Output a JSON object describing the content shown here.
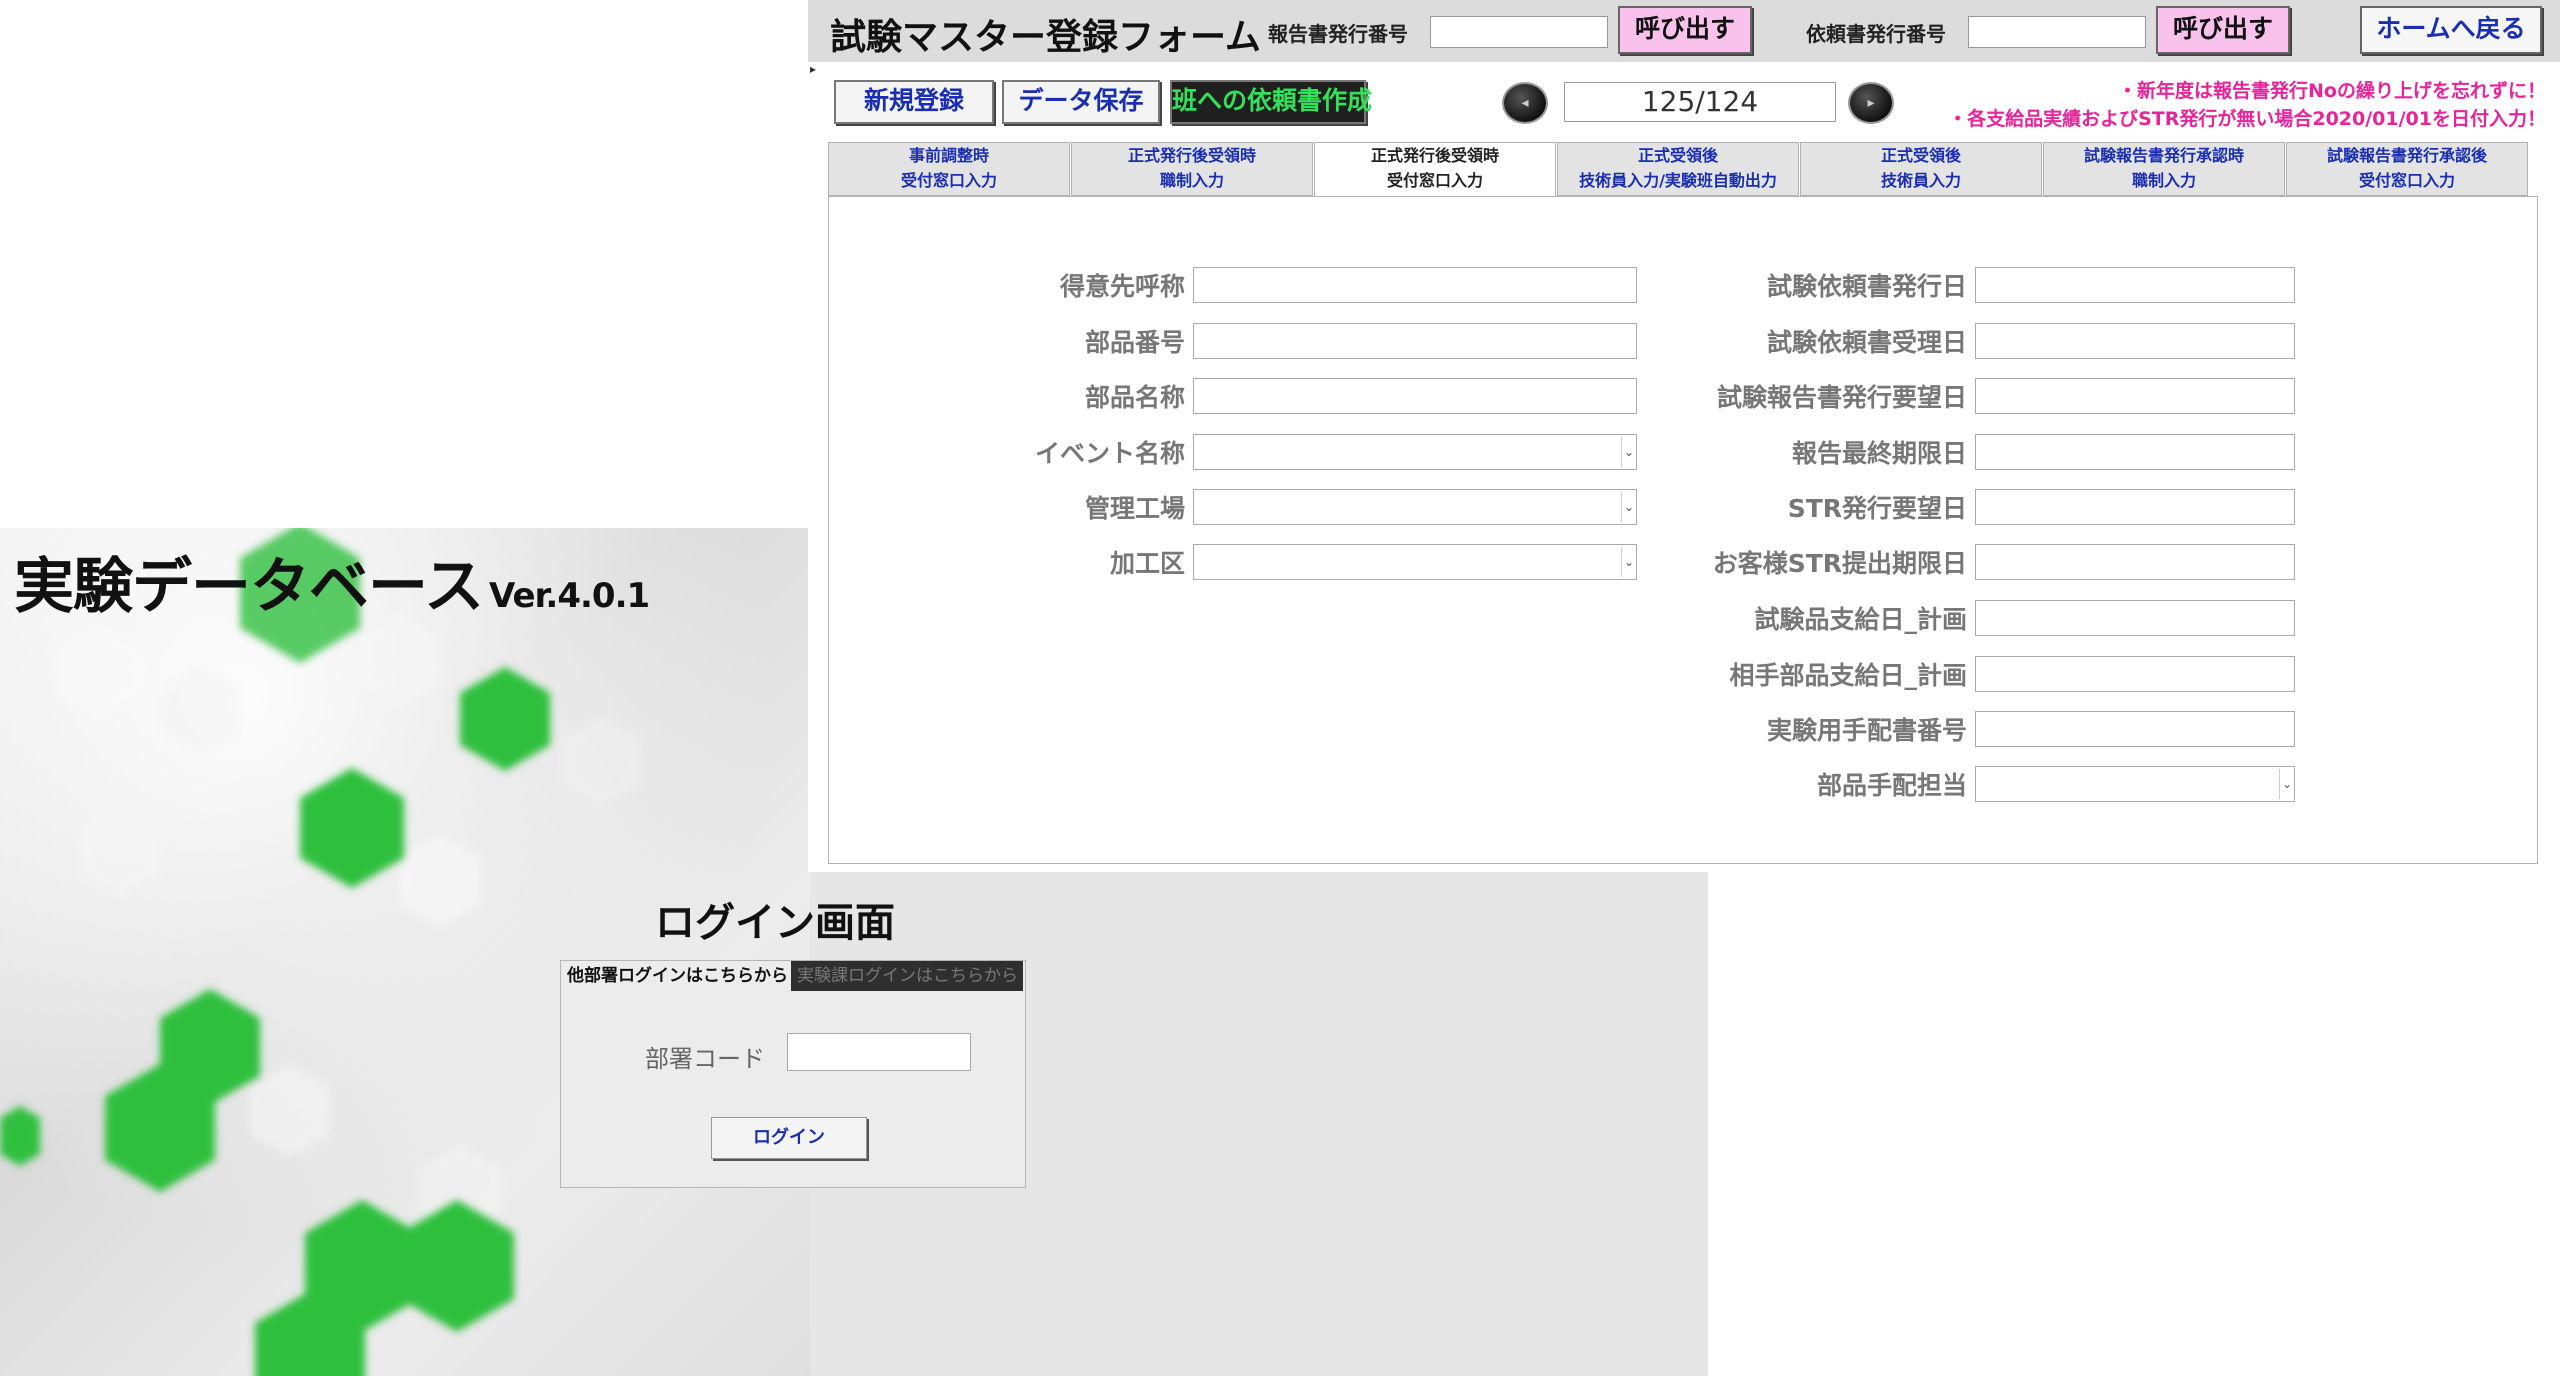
{
  "login_screen": {
    "app_title": "実験データベース",
    "version": "Ver.4.0.1",
    "login_title": "ログイン画面",
    "tabs": [
      {
        "label": "他部署ログインはこちらから"
      },
      {
        "label": "実験課ログインはこちらから"
      }
    ],
    "dept_code_label": "部署コード",
    "dept_code_value": "",
    "login_button": "ログイン"
  },
  "main_form": {
    "title": "試験マスター登録フォーム",
    "report_no_label": "報告書発行番号",
    "report_no_value": "",
    "call_button_1": "呼び出す",
    "request_no_label": "依頼書発行番号",
    "request_no_value": "",
    "call_button_2": "呼び出す",
    "home_button": "ホームへ戻る",
    "toolbar": {
      "new_label": "新規登録",
      "save_label": "データ保存",
      "request_label": "班への依頼書作成"
    },
    "record_counter": "125/124",
    "notices": [
      "・新年度は報告書発行Noの繰り上げを忘れずに！",
      "・各支給品実績およびSTR発行が無い場合2020/01/01を日付入力！"
    ],
    "tabs": [
      {
        "line1": "事前調整時",
        "line2": "受付窓口入力"
      },
      {
        "line1": "正式発行後受領時",
        "line2": "職制入力"
      },
      {
        "line1": "正式発行後受領時",
        "line2": "受付窓口入力"
      },
      {
        "line1": "正式受領後",
        "line2": "技術員入力/実験班自動出力"
      },
      {
        "line1": "正式受領後",
        "line2": "技術員入力"
      },
      {
        "line1": "試験報告書発行承認時",
        "line2": "職制入力"
      },
      {
        "line1": "試験報告書発行承認後",
        "line2": "受付窓口入力"
      }
    ],
    "active_tab": 2,
    "left_fields": [
      {
        "label": "得意先呼称",
        "value": ""
      },
      {
        "label": "部品番号",
        "value": ""
      },
      {
        "label": "部品名称",
        "value": ""
      },
      {
        "label": "イベント名称",
        "value": ""
      },
      {
        "label": "管理工場",
        "value": ""
      },
      {
        "label": "加工区",
        "value": ""
      }
    ],
    "right_fields": [
      {
        "label": "試験依頼書発行日",
        "value": ""
      },
      {
        "label": "試験依頼書受理日",
        "value": ""
      },
      {
        "label": "試験報告書発行要望日",
        "value": ""
      },
      {
        "label": "報告最終期限日",
        "value": ""
      },
      {
        "label": "STR発行要望日",
        "value": ""
      },
      {
        "label": "お客様STR提出期限日",
        "value": ""
      },
      {
        "label": "試験品支給日_計画",
        "value": ""
      },
      {
        "label": "相手部品支給日_計画",
        "value": ""
      },
      {
        "label": "実験用手配書番号",
        "value": ""
      },
      {
        "label": "部品手配担当",
        "value": ""
      }
    ]
  },
  "colors": {
    "link_blue": "#1a2fb0",
    "notice_pink": "#e8249a",
    "call_button_pink": "#f9c2ec",
    "hex_green": "#2fbf3e",
    "request_button_text": "#34e05a"
  }
}
